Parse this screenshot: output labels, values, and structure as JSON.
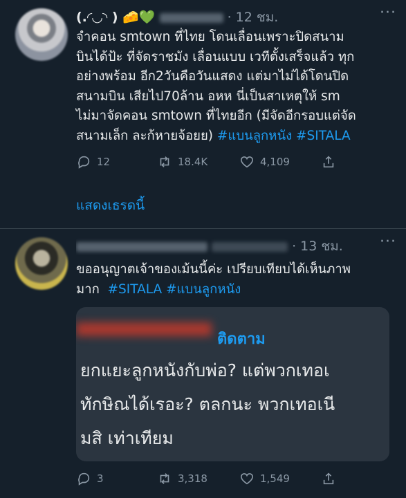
{
  "tweet1": {
    "display_name": "(.◜◡◝ ) 🧀💚",
    "time": "· 12 ชม.",
    "more": "···",
    "text": "จำคอน smtown ที่ไทย โดนเลื่อนเพราะปิดสนาม\nบินได้ป้ะ ที่จัดราชมัง เลื่อนแบบ เวทีตั้งเสร็จแล้ว ทุก\nอย่างพร้อม อีก2วันคือวันแสดง แต่มาไม่ได้โดนปิด\nสนามบิน เสียไป70ล้าน อหห นี่เป็นสาเหตุให้ sm\nไม่มาจัดคอน smtown ที่ไทยอีก (มีจัดอีกรอบแต่จัด\nสนามเล็ก ละก้หายจ้อยย) ",
    "hashtags": "#แบนลูกหนัง #SITALA",
    "replies": "12",
    "retweets": "18.4K",
    "likes": "4,109",
    "show_thread": "แสดงเธรดนี้"
  },
  "tweet2": {
    "time": "· 13 ชม.",
    "more": "···",
    "text": "ขออนุญาตเจ้าของเม้นนี้ค่ะ เปรียบเทียบได้เห็นภาพ\nมาก  ",
    "hashtags": "#SITALA #แบนลูกหนัง",
    "quote": {
      "follow": "ติดตาม",
      "line1": "ยกแยะลูกหนังกับพ่อ? แต่พวกเทอเ",
      "line2": "ทักษิณได้เรอะ? ตลกนะ พวกเทอเนี",
      "line3": "มสิ เท่าเทียม"
    },
    "replies": "3",
    "retweets": "3,318",
    "likes": "1,549"
  }
}
